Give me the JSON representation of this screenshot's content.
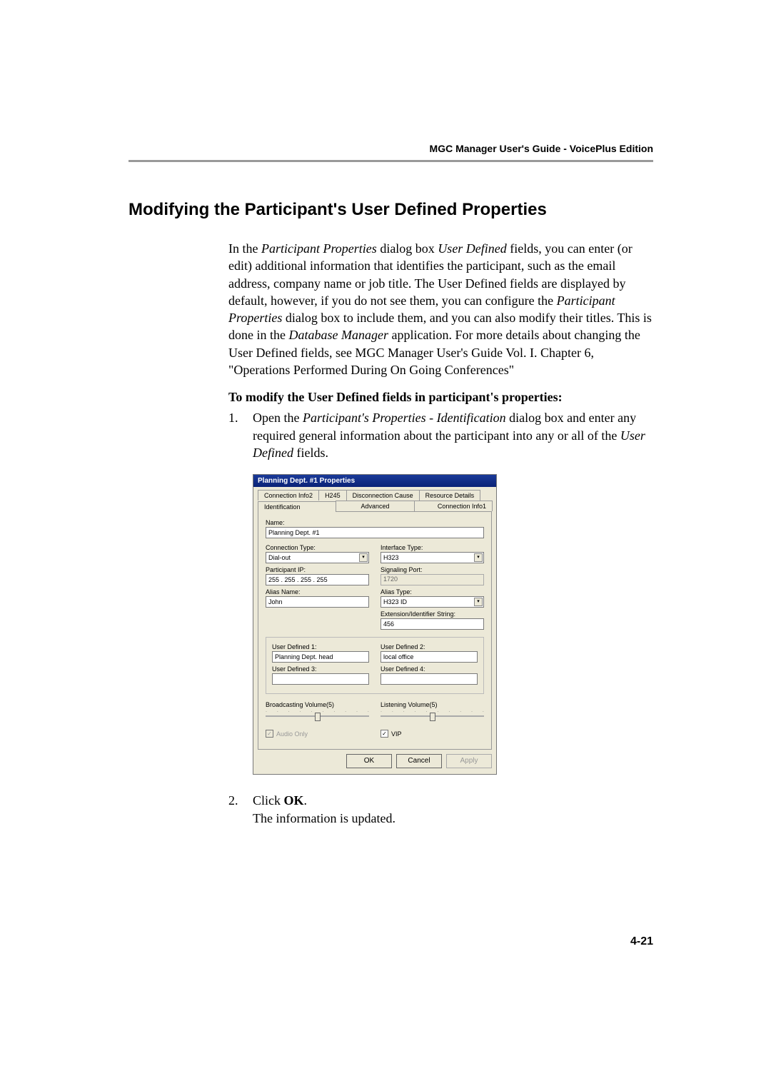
{
  "header": {
    "right": "MGC Manager User's Guide - VoicePlus Edition"
  },
  "section_title": "Modifying the Participant's User Defined Properties",
  "intro": {
    "pre1": "In the ",
    "it1": "Participant Properties",
    "mid1": " dialog box ",
    "it2": "User Defined",
    "mid2": " fields, you can enter (or edit) additional information that identifies the participant, such as the email address, company name or job title. The User Defined fields are displayed by default, however, if you do not see them, you can configure the ",
    "it3": "Participant Properties",
    "mid3": " dialog box to include them, and you can also modify their titles. This is done in the ",
    "it4": "Database Manager",
    "mid4": " application. For more details about changing the User Defined fields, see MGC Manager User's Guide Vol. I. Chapter  6, \"Operations Performed During On Going Conferences\""
  },
  "sub_heading": "To modify the User Defined fields in participant's properties:",
  "step1": {
    "num": "1.",
    "pre": "Open the ",
    "it1": "Participant's Properties - Identification",
    "mid": " dialog box and enter any required general information about the participant into any or all of the ",
    "it2": "User Defined",
    "post": " fields."
  },
  "dialog": {
    "title": "Planning Dept. #1 Properties",
    "tabs_row1": [
      "Connection Info2",
      "H245",
      "Disconnection Cause",
      "Resource Details"
    ],
    "tabs_row2": [
      "Identification",
      "Advanced",
      "Connection Info1"
    ],
    "name_label": "Name:",
    "name_value": "Planning Dept. #1",
    "conn_type_label": "Connection Type:",
    "conn_type_value": "Dial-out",
    "iface_label": "Interface Type:",
    "iface_value": "H323",
    "part_ip_label": "Participant IP:",
    "part_ip_value": "255 . 255 . 255 . 255",
    "sig_port_label": "Signaling Port:",
    "sig_port_value": "1720",
    "alias_name_label": "Alias Name:",
    "alias_name_value": "John",
    "alias_type_label": "Alias Type:",
    "alias_type_value": "H323 ID",
    "ext_label": "Extension/Identifier String:",
    "ext_value": "456",
    "ud1_label": "User Defined 1:",
    "ud1_value": "Planning Dept. head",
    "ud2_label": "User Defined 2:",
    "ud2_value": "local office",
    "ud3_label": "User Defined 3:",
    "ud3_value": "",
    "ud4_label": "User Defined 4:",
    "ud4_value": "",
    "broad_label": "Broadcasting Volume(5)",
    "listen_label": "Listening Volume(5)",
    "audio_only_label": "Audio Only",
    "vip_label": "VIP",
    "ok": "OK",
    "cancel": "Cancel",
    "apply": "Apply"
  },
  "step2": {
    "num": "2.",
    "pre": "Click ",
    "bold": "OK",
    "post": ".",
    "line2": "The information is updated."
  },
  "footer_page": "4-21"
}
